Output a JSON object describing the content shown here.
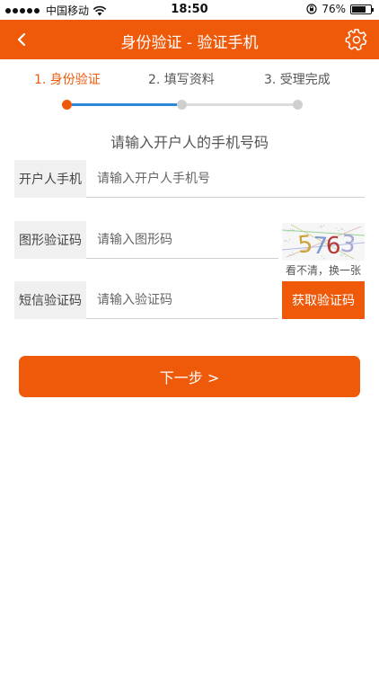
{
  "status_bar": {
    "carrier": "中国移动",
    "time": "18:50",
    "battery": "76%",
    "battery_level": 0.76
  },
  "nav": {
    "title": "身份验证 - 验证手机"
  },
  "steps": [
    {
      "label": "1. 身份验证",
      "active": true
    },
    {
      "label": "2. 填写资料",
      "active": false
    },
    {
      "label": "3. 受理完成",
      "active": false
    }
  ],
  "instruction": "请输入开户人的手机号码",
  "form": {
    "phone": {
      "label": "开户人手机",
      "placeholder": "请输入开户人手机号",
      "value": ""
    },
    "captcha": {
      "label": "图形验证码",
      "placeholder": "请输入图形码",
      "value": "",
      "image_text": "5763",
      "refresh_label": "看不清，换一张"
    },
    "sms": {
      "label": "短信验证码",
      "placeholder": "请输入验证码",
      "value": "",
      "button_label": "获取验证码"
    }
  },
  "next_button": "下一步 >",
  "colors": {
    "accent": "#ee5a0a",
    "progress": "#2d86d6",
    "inactive": "#cfcfcf"
  }
}
